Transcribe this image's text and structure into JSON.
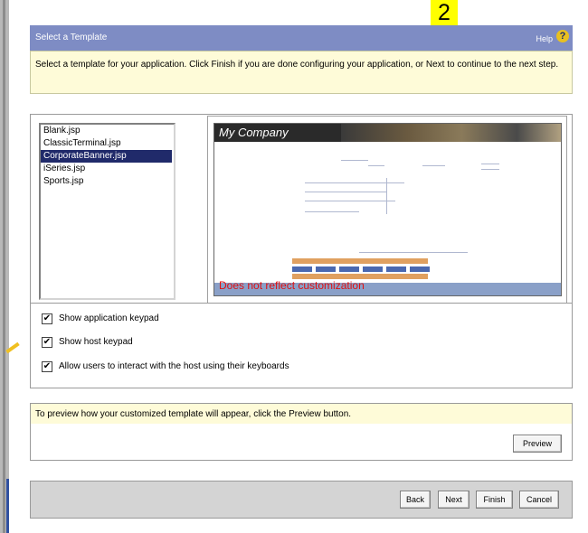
{
  "annotation": {
    "step_number": "2"
  },
  "header": {
    "title": "Select a Template",
    "help_label": "Help"
  },
  "instructions": "Select a template for your application. Click Finish if you are done configuring your application, or Next to continue to the next step.",
  "templates": {
    "items": [
      "Blank.jsp",
      "ClassicTerminal.jsp",
      "CorporateBanner.jsp",
      "iSeries.jsp",
      "Sports.jsp"
    ],
    "selected": "CorporateBanner.jsp"
  },
  "preview_image": {
    "company_name": "My Company",
    "warning": "Does not reflect customization"
  },
  "options": [
    {
      "label": "Show application keypad",
      "checked": true
    },
    {
      "label": "Show host keypad",
      "checked": true
    },
    {
      "label": "Allow users to interact with the host using their keyboards",
      "checked": true
    }
  ],
  "preview_section": {
    "hint": "To preview how your customized template will appear, click the Preview button.",
    "preview_button": "Preview"
  },
  "navigation": {
    "back": "Back",
    "next": "Next",
    "finish": "Finish",
    "cancel": "Cancel"
  },
  "colors": {
    "title_bar": "#7e8cc4",
    "info_strip": "#fefbd8",
    "selection": "#202a6a",
    "warning_text": "#e01010",
    "step_badge": "#ffff00"
  }
}
